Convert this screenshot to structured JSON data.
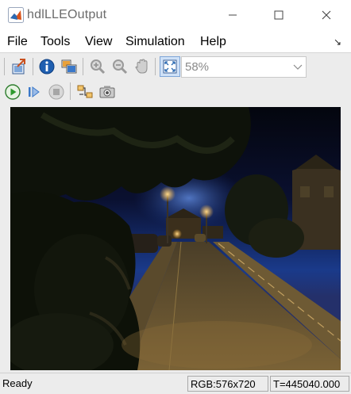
{
  "window": {
    "title": "hdlLLEOutput",
    "icon": "matlab-simulink-icon",
    "controls": [
      "minimize-icon",
      "maximize-icon",
      "close-icon"
    ]
  },
  "menu": {
    "items": [
      "File",
      "Tools",
      "View",
      "Simulation",
      "Help"
    ],
    "overflow_icon": "dock-arrow-icon"
  },
  "toolbar1": {
    "buttons": [
      "export-to-workspace-icon",
      "info-icon",
      "maintain-fit-icon",
      "zoom-in-icon",
      "zoom-out-icon",
      "pan-hand-icon",
      "fit-to-window-icon"
    ],
    "zoom_value": "58%"
  },
  "toolbar2": {
    "buttons": [
      "run-icon",
      "step-forward-icon",
      "stop-icon",
      "highlight-block-icon",
      "snapshot-camera-icon"
    ]
  },
  "status": {
    "state": "Ready",
    "rgb": "RGB:576x720",
    "time": "T=445040.000"
  },
  "colors": {
    "toolbar_bg": "#ececec",
    "sky_top": "#0a1030",
    "sky_horizon": "#1a3a8a",
    "street_light": "#ffb43c",
    "run_green": "#2e9a2e",
    "info_blue": "#1f5fb0"
  }
}
